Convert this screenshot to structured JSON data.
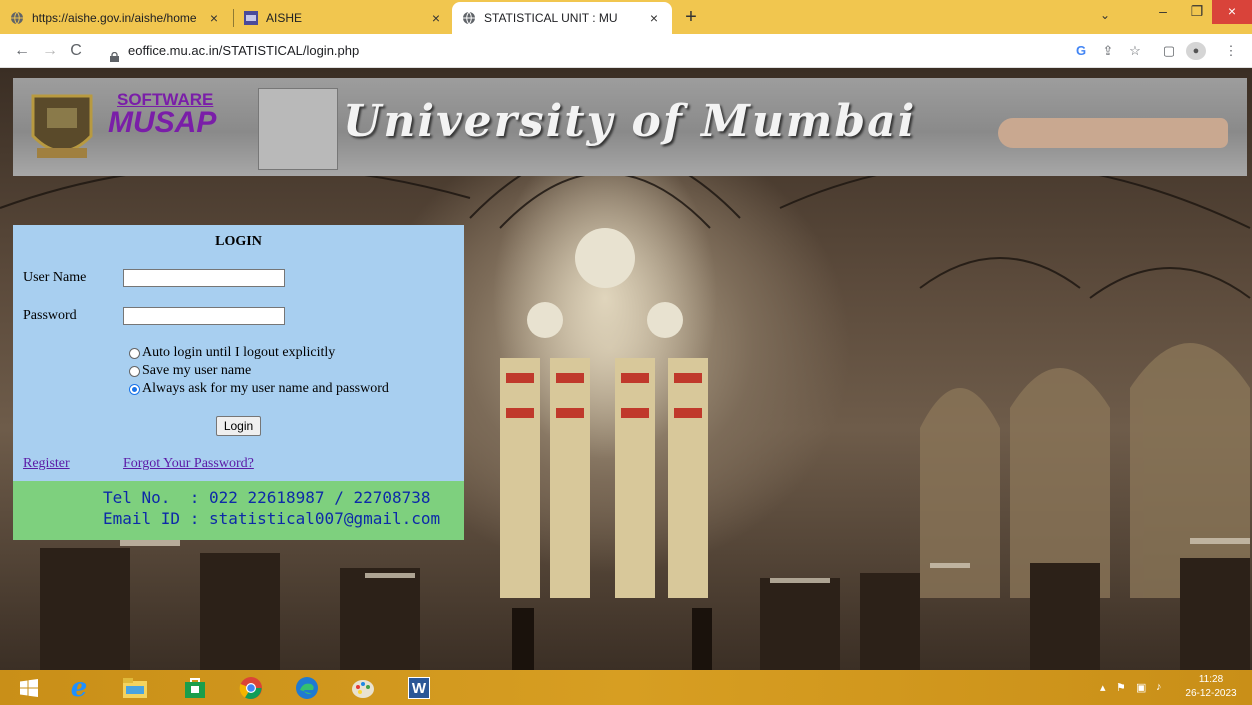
{
  "browser": {
    "tabs": [
      {
        "title": "https://aishe.gov.in/aishe/home",
        "close": "×",
        "icon": "globe-icon"
      },
      {
        "title": "AISHE",
        "close": "×",
        "icon": "aishe-favicon"
      },
      {
        "title": "STATISTICAL UNIT : MU",
        "close": "×",
        "icon": "globe-icon"
      }
    ],
    "new_tab": "+",
    "tab_search": "⌄",
    "window": {
      "minimize": "–",
      "maximize": "❐",
      "close": "×"
    },
    "url": "eoffice.mu.ac.in/STATISTICAL/login.php",
    "nav": {
      "back": "←",
      "forward": "→",
      "reload": "C"
    },
    "toolbar_icons": {
      "google": "G",
      "share": "⇪",
      "bookmark": "☆",
      "sidebar": "▢",
      "profile": "●",
      "menu": "⋮"
    }
  },
  "banner": {
    "software_label": "SOFTWARE",
    "brand": "MUSAP",
    "title": "University of Mumbai"
  },
  "login": {
    "heading": "LOGIN",
    "username_label": "User Name",
    "username_value": "",
    "password_label": "Password",
    "password_value": "",
    "options": [
      {
        "label": "Auto login until I logout explicitly",
        "selected": false
      },
      {
        "label": "Save my user name",
        "selected": false
      },
      {
        "label": "Always ask for my user name and password",
        "selected": true
      }
    ],
    "button": "Login",
    "register": "Register",
    "forgot": "Forgot Your Password?"
  },
  "contact": {
    "tel": "Tel No.  : 022 22618987 / 22708738",
    "email": "Email ID : statistical007@gmail.com"
  },
  "taskbar": {
    "time": "11:28",
    "date": "26-12-2023",
    "apps": [
      "windows-start-icon",
      "internet-explorer-icon",
      "file-explorer-icon",
      "store-icon",
      "chrome-icon",
      "edge-icon",
      "paint-icon",
      "word-icon"
    ],
    "word_label": "W"
  },
  "colors": {
    "tabbar": "#f1c64f",
    "login_panel": "#a8cff0",
    "contact_panel": "#7ed07e",
    "contact_text": "#0d2aa8",
    "brand_purple": "#7a1ea8",
    "link": "#5b1aa6"
  }
}
